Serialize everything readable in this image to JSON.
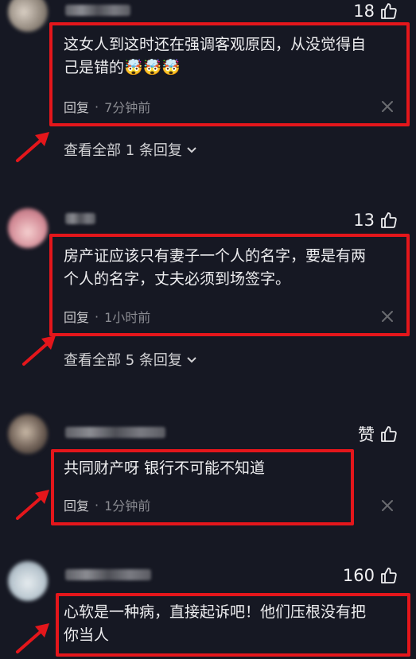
{
  "comments": [
    {
      "likes": "18",
      "text_lines": [
        "这女人到这时还在强调客观原因，从没觉得自",
        "己是错的🤯🤯🤯"
      ],
      "reply_label": "回复",
      "separator": "·",
      "time": "7分钟前",
      "view_replies": "查看全部 1 条回复"
    },
    {
      "likes": "13",
      "text_lines": [
        "房产证应该只有妻子一个人的名字，要是有两",
        "个人的名字，丈夫必须到场签字。"
      ],
      "reply_label": "回复",
      "separator": "·",
      "time": "1小时前",
      "view_replies": "查看全部 5 条回复"
    },
    {
      "likes": "赞",
      "text_lines": [
        "共同财产呀 银行不可能不知道"
      ],
      "reply_label": "回复",
      "separator": "·",
      "time": "1分钟前"
    },
    {
      "likes": "160",
      "text_lines": [
        "心软是一种病，直接起诉吧！他们压根没有把",
        "你当人"
      ]
    }
  ],
  "colors": {
    "background": "#161823",
    "highlight_box": "#e4161b",
    "meta_text": "#8a8b91"
  },
  "icons": [
    "thumbs-up-icon",
    "close-icon",
    "chevron-down-icon",
    "red-arrow-annotation"
  ]
}
